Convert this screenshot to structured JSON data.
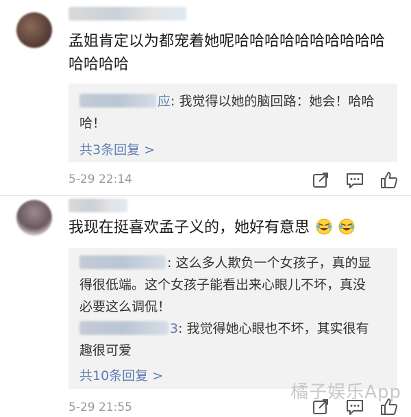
{
  "comments": [
    {
      "text_line1": "孟姐肯定以为都宠着她呢哈哈哈哈哈哈哈哈哈哈",
      "text_line2": "哈哈哈哈",
      "replies": [
        {
          "name_suffix": "应",
          "line1": ": 我觉得以她的脑回路：她会！哈哈",
          "line2": "哈！"
        }
      ],
      "more_label": "共3条回复 >",
      "timestamp": "5-29 22:14"
    },
    {
      "text": "我现在挺喜欢孟子义的，她好有意思",
      "replies": [
        {
          "name_suffix": "",
          "line1": ": 这么多人欺负一个女孩子，真的显",
          "line2": "得很低端。这个女孩子能看出来心眼儿不坏，真没",
          "line3": "必要这么调侃！"
        },
        {
          "name_suffix": "3",
          "line1": ": 我觉得她心眼也不坏，其实很有",
          "line2": "趣很可爱"
        }
      ],
      "more_label": "共10条回复 >",
      "timestamp": "5-29 21:55"
    }
  ],
  "watermark": "橘子娱乐App",
  "colors": {
    "link": "#5b7bb2",
    "reply_bg": "#f2f2f2",
    "timestamp": "#999999"
  },
  "icons": [
    "share-icon",
    "comment-icon",
    "like-icon",
    "crying-laughing-emoji"
  ]
}
